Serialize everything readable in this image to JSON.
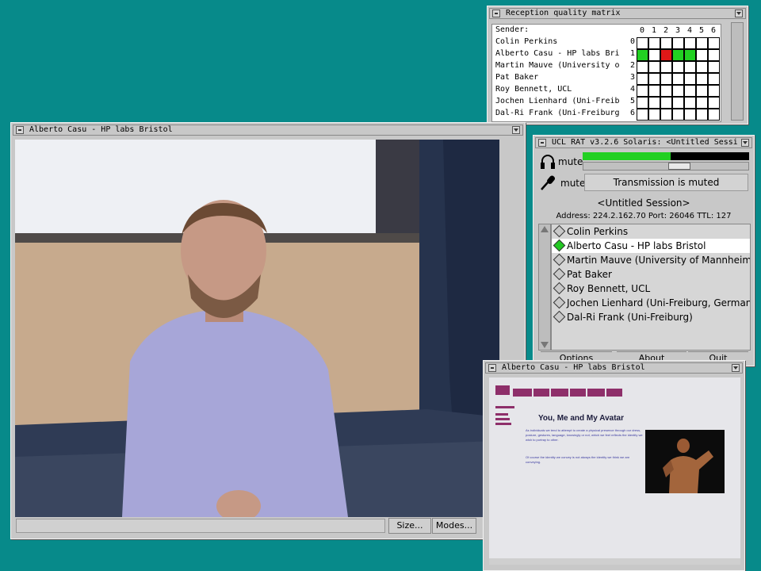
{
  "matrix": {
    "title": "Reception quality matrix",
    "sender_label": "Sender:",
    "columns": [
      "0",
      "1",
      "2",
      "3",
      "4",
      "5",
      "6"
    ],
    "senders": [
      "Colin Perkins",
      "Alberto Casu - HP labs Bri",
      "Martin Mauve (University o",
      "Pat Baker",
      "Roy Bennett, UCL",
      "Jochen Lienhard (Uni-Freib",
      "Dal-Ri Frank (Uni-Freiburg"
    ],
    "row_indices": [
      "0",
      "1",
      "2",
      "3",
      "4",
      "5",
      "6"
    ],
    "cells_row1": [
      "green",
      "white",
      "red",
      "green",
      "green",
      "white",
      "white"
    ]
  },
  "video": {
    "title": "Alberto Casu - HP labs Bristol",
    "size_label": "Size...",
    "modes_label": "Modes..."
  },
  "rat": {
    "title": "UCL RAT v3.2.6 Solaris: <Untitled Sessi",
    "mute_label_speaker": "mute",
    "mute_label_mic": "mute",
    "tx_status": "Transmission is muted",
    "session_name": "<Untitled Session>",
    "address": "Address: 224.2.162.70 Port: 26046 TTL: 127",
    "speaker_level": 0.53,
    "participants": [
      "Colin Perkins",
      "Alberto Casu - HP labs Bristol",
      "Martin Mauve (University of Mannheim)",
      "Pat Baker",
      "Roy Bennett, UCL",
      "Jochen Lienhard (Uni-Freiburg, Germany",
      "Dal-Ri Frank (Uni-Freiburg)"
    ],
    "selected_index": 1,
    "options_label": "Options",
    "about_label": "About",
    "quit_label": "Quit"
  },
  "web": {
    "title": "Alberto Casu - HP labs Bristol",
    "heading": "You, Me and My Avatar",
    "para1": "As individuals we tend to attempt to create a physical presence through our dress, posture, gestures, language, knowingly or not, which we feel reflects the identity we wish to portray to other.",
    "para2": "Of course the identity we convey is not always the identity we think we are conveying."
  },
  "colors": {
    "desktop": "#078a8a",
    "green": "#22d022",
    "red": "#e01818",
    "selected_row": "#ffffff"
  }
}
